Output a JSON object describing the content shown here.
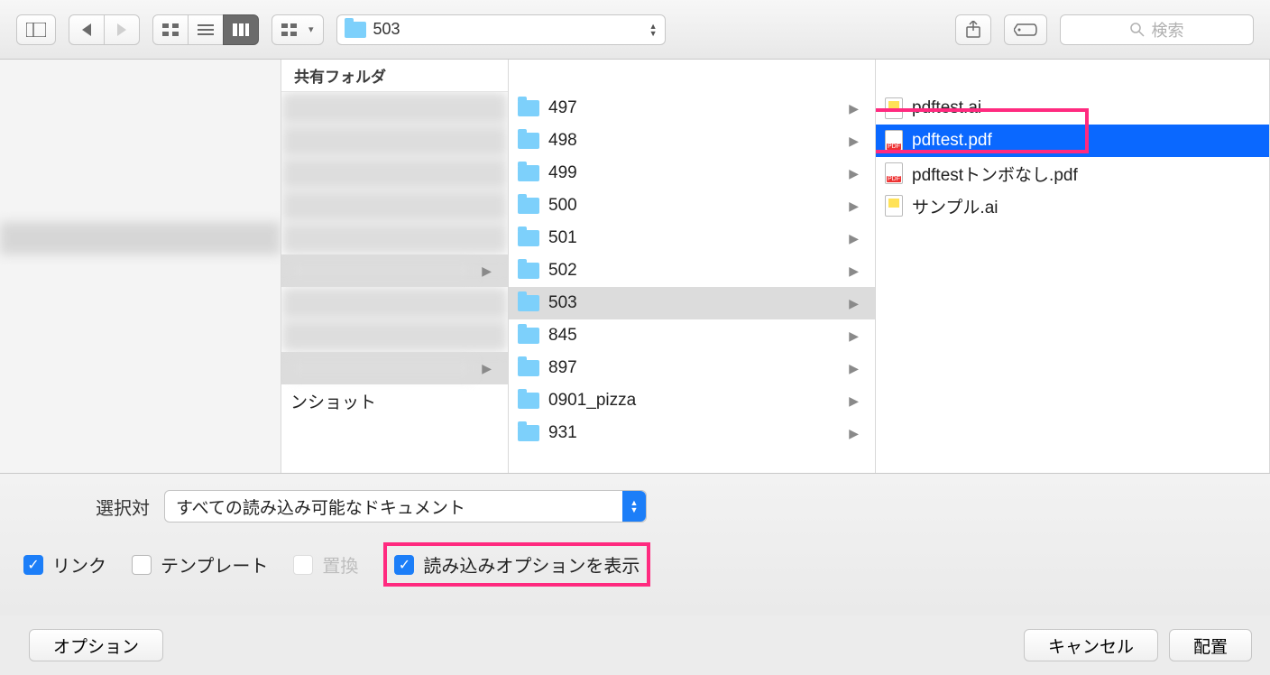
{
  "toolbar": {
    "path_label": "503",
    "search_placeholder": "検索"
  },
  "header_title": "共有フォルダ",
  "col2_partial": "ンショット",
  "col3_folders": [
    "497",
    "498",
    "499",
    "500",
    "501",
    "502",
    "503",
    "845",
    "897",
    "0901_pizza",
    "931"
  ],
  "col3_selected_index": 6,
  "col4_files": [
    {
      "name": "pdftest.ai",
      "type": "ai"
    },
    {
      "name": "pdftest.pdf",
      "type": "pdf",
      "selected": true,
      "callout": true
    },
    {
      "name": "pdftestトンボなし.pdf",
      "type": "pdf"
    },
    {
      "name": "サンプル.ai",
      "type": "ai"
    }
  ],
  "options": {
    "filter_label": "選択対",
    "filter_value": "すべての読み込み可能なドキュメント",
    "chk_link": "リンク",
    "chk_template": "テンプレート",
    "chk_replace": "置換",
    "chk_showopts": "読み込みオプションを表示"
  },
  "footer": {
    "options_btn": "オプション",
    "cancel_btn": "キャンセル",
    "place_btn": "配置"
  }
}
